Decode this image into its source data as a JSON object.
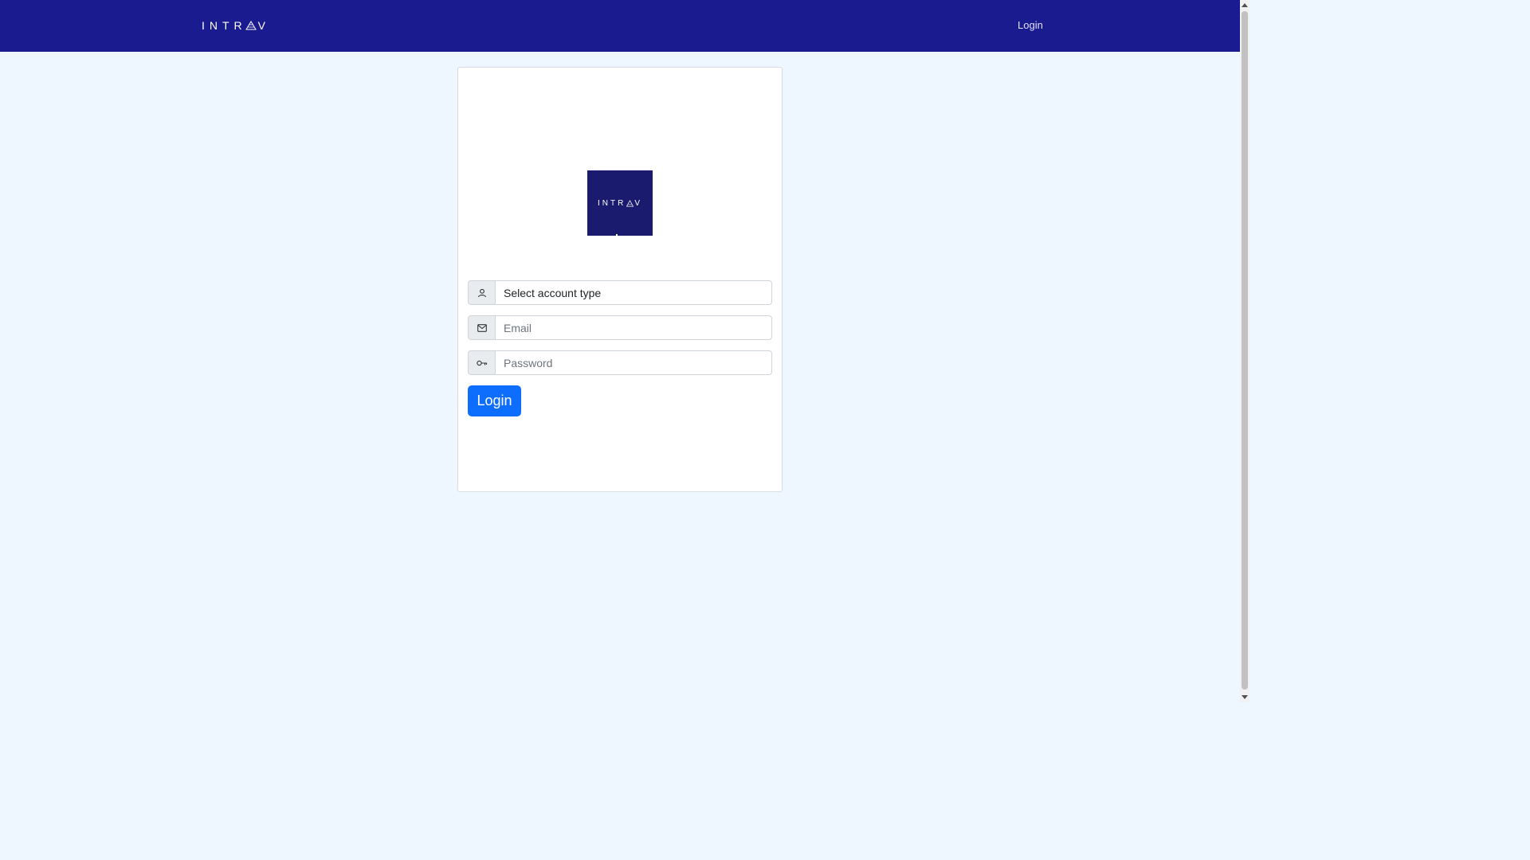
{
  "navbar": {
    "brand_prefix": "INTR",
    "brand_suffix": "V",
    "login_link": "Login"
  },
  "card": {
    "logo": {
      "prefix": "INTR",
      "suffix": "V"
    },
    "account_type": {
      "value": "Select account type"
    },
    "email": {
      "placeholder": "Email",
      "value": ""
    },
    "password": {
      "placeholder": "Password",
      "value": ""
    },
    "submit_label": "Login"
  },
  "colors": {
    "navbar_bg": "#1a1b8f",
    "page_bg": "#eef6ff",
    "primary_button": "#0d6efd",
    "logo_bg": "#1a1b6e"
  },
  "icons": {
    "account": "user-icon",
    "email": "envelope-icon",
    "password": "key-icon"
  }
}
